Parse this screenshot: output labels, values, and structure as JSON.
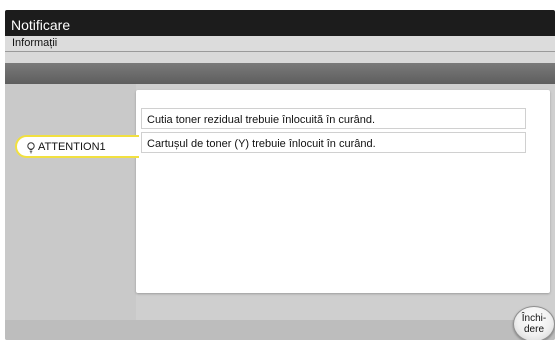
{
  "window": {
    "title": "Notificare",
    "subtitle": "Informații"
  },
  "attention": {
    "label": "ATTENTION1"
  },
  "messages": [
    "Cutia toner rezidual trebuie înlocuită în curând.",
    "Cartușul de toner (Y) trebuie înlocuit în curând."
  ],
  "close_button": {
    "line1": "Închi-",
    "line2": "dere"
  },
  "icons": {
    "attention": "lightbulb-icon"
  },
  "colors": {
    "attention_border": "#f1e040",
    "titlebar": "#1c1c1c"
  }
}
